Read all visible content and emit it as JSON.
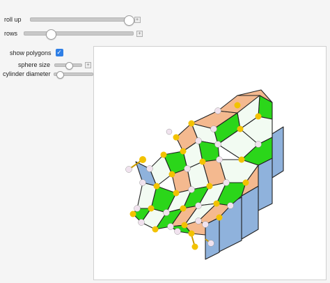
{
  "controls": {
    "roll_up": {
      "label": "roll up",
      "value": 0.98
    },
    "rows": {
      "label": "rows",
      "value": 0.24
    },
    "show_polygons": {
      "label": "show polygons",
      "checked": true
    },
    "sphere_size": {
      "label": "sphere size",
      "value": 0.5
    },
    "cylinder_diameter": {
      "label": "cylinder diameter",
      "value": 0.15
    }
  },
  "icons": {
    "plus": "+",
    "check": "✓"
  },
  "colors": {
    "accent": "#2f7fe6",
    "hexagon_fill": "#f2fbf2",
    "rhombus_orange": "#f4b98f",
    "rhombus_green": "#2bd61a",
    "rhombus_blue": "#8fb2dc",
    "sphere_yellow": "#f2c200",
    "sphere_pink": "#f0e2ee"
  }
}
